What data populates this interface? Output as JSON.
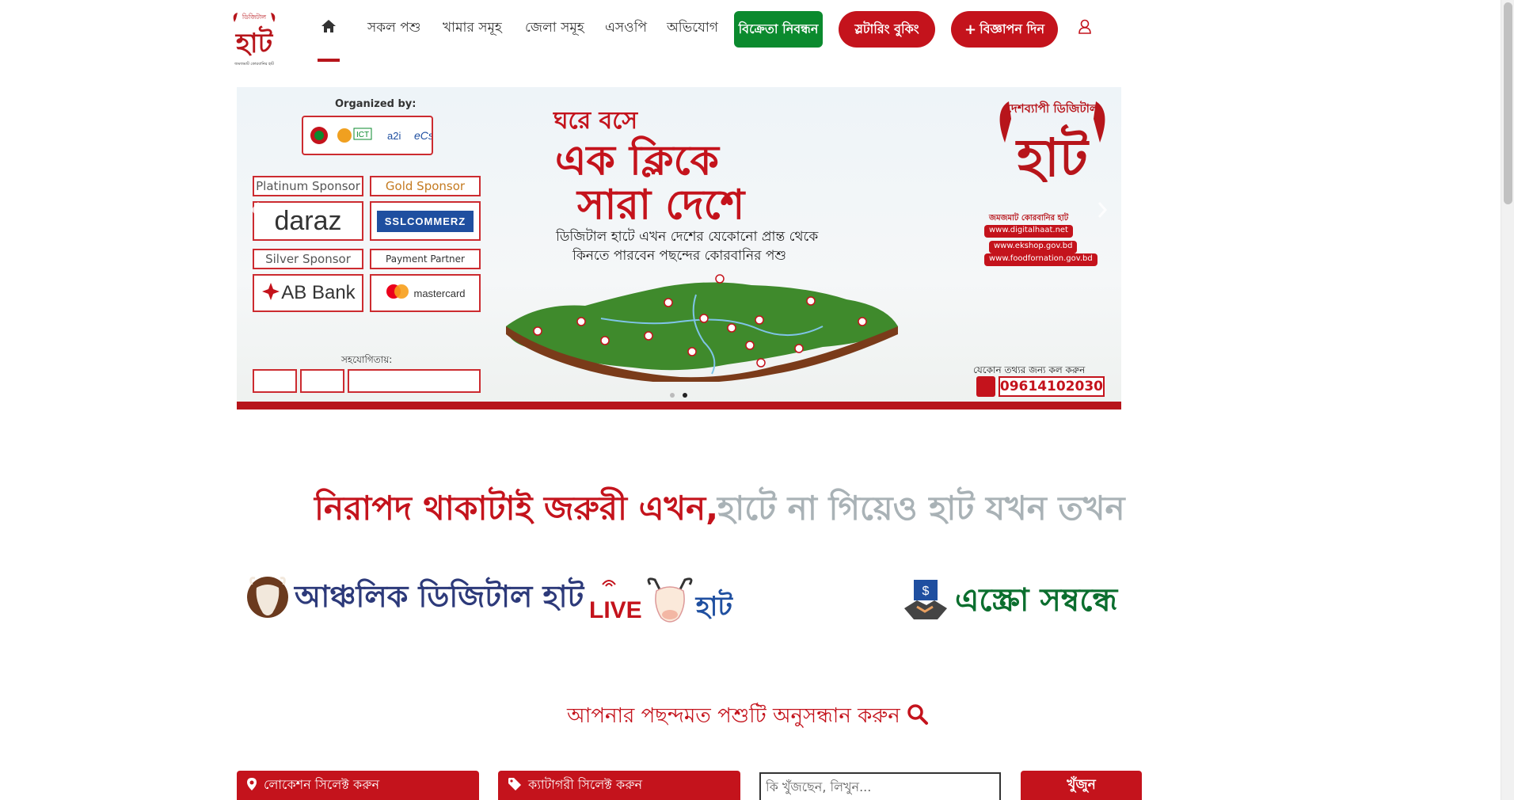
{
  "brand": {
    "logo_top": "ডিজিটাল",
    "logo_main": "হাট",
    "logo_bottom": "জমজমাট কোরবানির হাট"
  },
  "nav": {
    "items": [
      "সকল পশু",
      "খামার সমূহ",
      "জেলা সমূহ",
      "এসওপি",
      "অভিযোগ"
    ],
    "seller_registration": "বিক্রেতা নিবন্ধন",
    "slaughter_booking": "স্লটারিং বুকিং",
    "post_ad": "বিজ্ঞাপন দিন"
  },
  "banner": {
    "organized_by": "Organized by:",
    "platinum": "Platinum Sponsor",
    "gold": "Gold Sponsor",
    "silver": "Silver Sponsor",
    "payment": "Payment Partner",
    "daraz": "daraz",
    "ssl": "SSLCOMMERZ",
    "abbank": "AB Bank",
    "mastercard": "mastercard",
    "helpers_label": "সহযোগিতায়:",
    "headline_1": "ঘরে বসে",
    "headline_2": "এক ক্লিকে",
    "headline_3": "সারা দেশে",
    "sub_1": "ডিজিটাল হাটে এখন দেশের যেকোনো প্রান্ত থেকে",
    "sub_2": "কিনতে পারবেন পছন্দের কোরবানির পশু",
    "right_top": "দেশব্যাপী ডিজিটাল",
    "right_main": "হাট",
    "right_tagline": "জমজমাট কোরবানির হাট",
    "url_1": "www.digitalhaat.net",
    "url_2": "www.ekshop.gov.bd",
    "url_3": "www.foodfornation.gov.bd",
    "call_label": "যেকোন তথ্যর জন্য কল করুন",
    "phone": "09614102030"
  },
  "tagline": {
    "part1": "নিরাপদ থাকাটাই জরুরী এখন,",
    "part2": "হাটে না গিয়েও হাট যখন তখন"
  },
  "features": {
    "regional": "আঞ্চলিক ডিজিটাল হাট",
    "live_1": "LIVE",
    "live_2": "হাট",
    "escrow": "এস্ক্রো সম্বন্ধে"
  },
  "search": {
    "title": "আপনার পছন্দমত পশুটি অনুসন্ধান করুন",
    "location": "লোকেশন সিলেক্ট করুন",
    "category": "ক্যাটাগরী সিলেক্ট করুন",
    "placeholder": "কি খুঁজছেন, লিখুন...",
    "button": "খুঁজুন"
  },
  "colors": {
    "brand_red": "#c4131c",
    "green": "#0b8a2e",
    "tagline_gray": "#a9b2b6"
  }
}
